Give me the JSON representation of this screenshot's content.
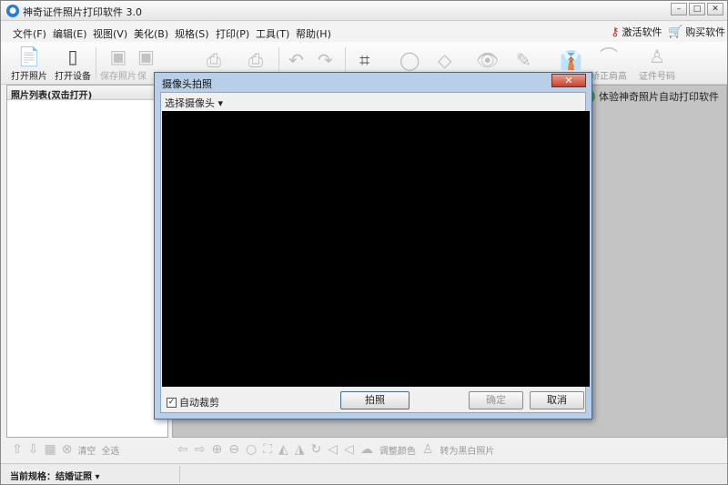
{
  "app": {
    "title": "神奇证件照片打印软件 3.0"
  },
  "menu": {
    "items": [
      "文件(F)",
      "编辑(E)",
      "视图(V)",
      "美化(B)",
      "规格(S)",
      "打印(P)",
      "工具(T)",
      "帮助(H)"
    ],
    "activate_label": "激活软件",
    "buy_label": "购买软件"
  },
  "toolbar": {
    "open_photo": "打开照片",
    "open_device": "打开设备",
    "save_photo": "保存照片",
    "save_as_partial": "保",
    "correct_shoulder": "矫正肩高",
    "id_number": "证件号码"
  },
  "left_panel": {
    "title": "照片列表(双击打开)"
  },
  "promo": {
    "text": "体验神奇照片自动打印软件"
  },
  "left_bottom": {
    "clear": "清空",
    "select_all": "全选"
  },
  "right_bottom": {
    "adjust_color": "调整颜色",
    "to_bw": "转为黑白照片"
  },
  "status": {
    "spec": "当前规格：结婚证照"
  },
  "dialog": {
    "title": "摄像头拍照",
    "close": "✕",
    "select_camera": "选择摄像头",
    "auto_crop": "自动裁剪",
    "auto_crop_checked": true,
    "capture": "拍照",
    "ok": "确定",
    "cancel": "取消"
  }
}
